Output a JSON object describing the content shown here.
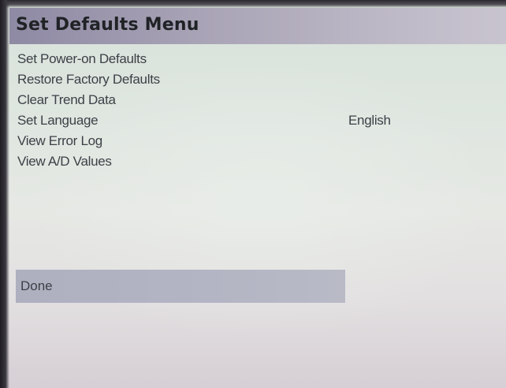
{
  "window": {
    "title": "Set Defaults Menu"
  },
  "menu": {
    "items": [
      {
        "label": "Set Power-on Defaults",
        "value": ""
      },
      {
        "label": "Restore Factory Defaults",
        "value": ""
      },
      {
        "label": "Clear Trend Data",
        "value": ""
      },
      {
        "label": "Set Language",
        "value": "English"
      },
      {
        "label": "View Error Log",
        "value": ""
      },
      {
        "label": "View A/D Values",
        "value": ""
      }
    ]
  },
  "footer": {
    "done_label": "Done"
  },
  "colors": {
    "title_bar": "#a9a4b6",
    "selected_highlight": "#b3b5c4",
    "text": "#3c4147"
  }
}
